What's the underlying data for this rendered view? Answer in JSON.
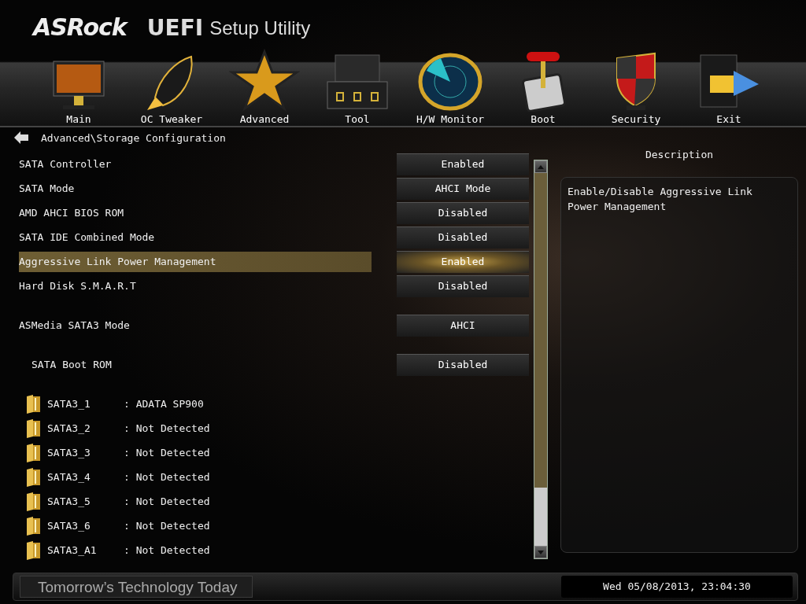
{
  "header": {
    "brand": "ASRock",
    "product": "UEFI",
    "subtitle": "Setup Utility"
  },
  "nav": [
    {
      "label": "Main"
    },
    {
      "label": "OC Tweaker"
    },
    {
      "label": "Advanced"
    },
    {
      "label": "Tool"
    },
    {
      "label": "H/W Monitor"
    },
    {
      "label": "Boot"
    },
    {
      "label": "Security"
    },
    {
      "label": "Exit"
    }
  ],
  "breadcrumb": "Advanced\\Storage Configuration",
  "sections": [
    {
      "items": [
        {
          "kind": "setting",
          "label": "SATA Controller",
          "value": "Enabled",
          "selected": false
        },
        {
          "kind": "setting",
          "label": "SATA Mode",
          "value": "AHCI Mode",
          "selected": false
        },
        {
          "kind": "setting",
          "label": "AMD AHCI BIOS ROM",
          "value": "Disabled",
          "selected": false
        },
        {
          "kind": "setting",
          "label": "SATA IDE Combined Mode",
          "value": "Disabled",
          "selected": false
        },
        {
          "kind": "setting",
          "label": "Aggressive Link Power Management",
          "value": "Enabled",
          "selected": true
        },
        {
          "kind": "setting",
          "label": "Hard Disk S.M.A.R.T",
          "value": "Disabled",
          "selected": false
        }
      ]
    },
    {
      "items": [
        {
          "kind": "setting",
          "label": "ASMedia SATA3 Mode",
          "value": "AHCI",
          "selected": false
        }
      ]
    },
    {
      "items": [
        {
          "kind": "subsetting",
          "label": "SATA Boot ROM",
          "value": "Disabled",
          "selected": false
        }
      ]
    }
  ],
  "ports": [
    {
      "name": "SATA3_1",
      "value": ": ADATA SP900"
    },
    {
      "name": "SATA3_2",
      "value": ": Not Detected"
    },
    {
      "name": "SATA3_3",
      "value": ": Not Detected"
    },
    {
      "name": "SATA3_4",
      "value": ": Not Detected"
    },
    {
      "name": "SATA3_5",
      "value": ": Not Detected"
    },
    {
      "name": "SATA3_6",
      "value": ": Not Detected"
    },
    {
      "name": "SATA3_A1",
      "value": ": Not Detected"
    }
  ],
  "description": {
    "title": "Description",
    "text": "Enable/Disable Aggressive Link Power Management"
  },
  "footer": {
    "slogan": "Tomorrow’s Technology Today",
    "datetime": "Wed 05/08/2013, 23:04:30"
  }
}
